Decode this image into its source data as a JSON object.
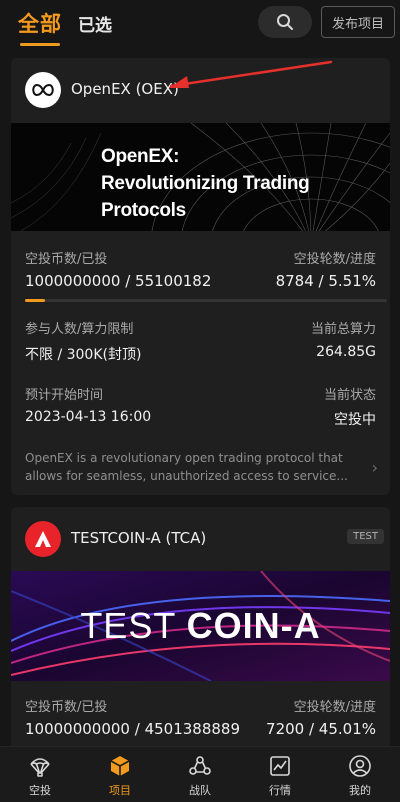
{
  "header": {
    "tab_all": "全部",
    "tab_selected": "已选",
    "publish_label": "发布项目",
    "search_icon": "search-icon"
  },
  "projects": [
    {
      "name": "OpenEX (OEX)",
      "badge": "",
      "banner_text": "OpenEX:\nRevolutionizing Trading\nProtocols",
      "airdrop_label": "空投币数/已投",
      "airdrop_value": "1000000000 / 55100182",
      "rounds_label": "空投轮数/进度",
      "rounds_value": "8784 / 5.51%",
      "progress": 0.0551,
      "participants_label": "参与人数/算力限制",
      "participants_value": "不限 / 300K(封顶)",
      "hashrate_label": "当前总算力",
      "hashrate_value": "264.85G",
      "start_label": "预计开始时间",
      "start_value": "2023-04-13 16:00",
      "status_label": "当前状态",
      "status_value": "空投中",
      "description": "OpenEX is a revolutionary open trading protocol that allows for seamless, unauthorized access to service..."
    },
    {
      "name": "TESTCOIN-A (TCA)",
      "badge": "TEST",
      "banner_text_1": "TEST ",
      "banner_text_2": "COIN-A",
      "airdrop_label": "空投币数/已投",
      "airdrop_value": "10000000000 / 4501388889",
      "rounds_label": "空投轮数/进度",
      "rounds_value": "7200 / 45.01%"
    }
  ],
  "nav": [
    {
      "label": "空投",
      "icon": "parachute-icon",
      "active": false
    },
    {
      "label": "项目",
      "icon": "cube-icon",
      "active": true
    },
    {
      "label": "战队",
      "icon": "team-icon",
      "active": false
    },
    {
      "label": "行情",
      "icon": "chart-icon",
      "active": false
    },
    {
      "label": "我的",
      "icon": "user-icon",
      "active": false
    }
  ],
  "colors": {
    "accent": "#f29a1f",
    "background": "#161616",
    "card": "#1f1f1f"
  }
}
